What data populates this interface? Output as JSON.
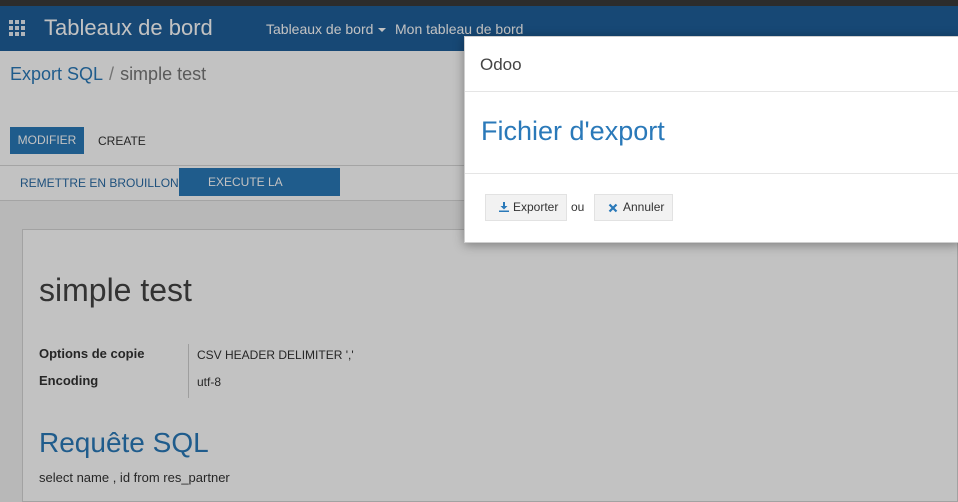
{
  "navbar": {
    "app_title": "Tableaux de bord",
    "menu_main": "Tableaux de bord",
    "menu_second": "Mon tableau de bord"
  },
  "breadcrumb": {
    "parent": "Export SQL",
    "separator": "/",
    "current": "simple test"
  },
  "toolbar": {
    "edit_label": "MODIFIER",
    "create_label": "CREATE"
  },
  "statusbar": {
    "reset_label": "REMETTRE EN BROUILLON",
    "execute_label": "EXECUTE LA REQUÊTE"
  },
  "form": {
    "name": "simple test",
    "fields": [
      {
        "label": "Options de copie",
        "value": "CSV HEADER DELIMITER ','"
      },
      {
        "label": "Encoding",
        "value": "utf-8"
      }
    ],
    "sql_title": "Requête SQL",
    "sql_value": "select name , id from res_partner"
  },
  "dialog": {
    "title": "Odoo",
    "heading": "Fichier d'export",
    "export_label": "Exporter",
    "or_text": "ou",
    "cancel_label": "Annuler",
    "export_icon": "download-icon",
    "cancel_icon": "close-icon"
  },
  "colors": {
    "navbar": "#1f5f9a",
    "primary": "#2a79b9"
  }
}
